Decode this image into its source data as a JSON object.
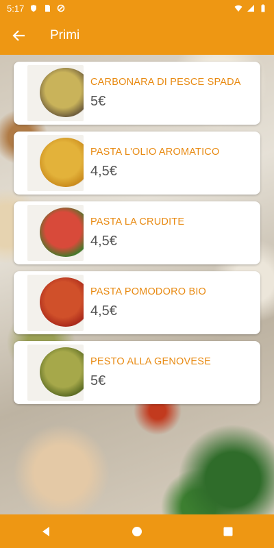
{
  "status_bar": {
    "time": "5:17"
  },
  "app_bar": {
    "title": "Primi"
  },
  "items": [
    {
      "name": "CARBONARA DI PESCE SPADA",
      "price": "5€",
      "food_color": "#c9b35a",
      "accent_color": "#6b5a3a"
    },
    {
      "name": "PASTA L'OLIO AROMATICO",
      "price": "4,5€",
      "food_color": "#e3b23a",
      "accent_color": "#c98a1c"
    },
    {
      "name": "PASTA LA CRUDITE",
      "price": "4,5€",
      "food_color": "#d84a3a",
      "accent_color": "#3f7a2a"
    },
    {
      "name": "PASTA POMODORO BIO",
      "price": "4,5€",
      "food_color": "#d0502a",
      "accent_color": "#a8281a"
    },
    {
      "name": "PESTO ALLA GENOVESE",
      "price": "5€",
      "food_color": "#a6a84a",
      "accent_color": "#5a6a22"
    }
  ],
  "colors": {
    "primary": "#ee9713",
    "item_name": "#e88a12"
  }
}
